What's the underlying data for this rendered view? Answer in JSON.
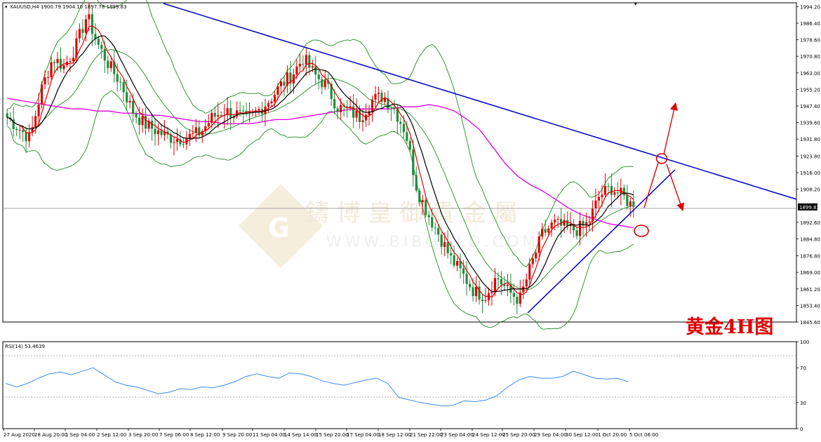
{
  "header": {
    "symbol": "XAUUSD,H4",
    "ohlc": "1900.79 1904.10 1897.78 1899.83"
  },
  "annotation_label": "黄金4H图",
  "watermark": {
    "cn": "鑄 博 皇 御 貴 金 屬",
    "en": "WWW.BIBGOLD.COM"
  },
  "rsi_header": "RSI(14) 53.4639",
  "colors": {
    "bull": "#e00000",
    "bear": "#1f8b3a",
    "ma_fast": "#e00000",
    "ma_slow": "#000000",
    "ma_long": "#e000e0",
    "bollinger": "#1f8b1f",
    "trendline": "#0000cc",
    "rsi": "#3c8cf0",
    "arrow": "#e00000"
  },
  "chart_data": [
    {
      "type": "candlestick",
      "title": "XAUUSD,H4",
      "ylim": [
        1845.6,
        1996.0
      ],
      "y_ticks": [
        "1994.20",
        "1986.40",
        "1978.60",
        "1970.80",
        "1963.00",
        "1955.20",
        "1947.40",
        "1939.60",
        "1931.80",
        "1923.80",
        "1916.00",
        "1908.20",
        "1899.83",
        "1892.60",
        "1884.80",
        "1876.80",
        "1869.00",
        "1861.20",
        "1853.40",
        "1845.60"
      ],
      "last_price": 1899.83,
      "x_tick_labels": [
        "27 Aug 2020",
        "28 Aug 20:00",
        "1 Sep 04:00",
        "2 Sep 12:00",
        "3 Sep 20:00",
        "7 Sep 06:00",
        "8 Sep 12:00",
        "9 Sep 20:00",
        "11 Sep 04:00",
        "14 Sep 14:00",
        "15 Sep 20:00",
        "17 Sep 04:00",
        "18 Sep 12:00",
        "21 Sep 22:00",
        "23 Sep 04:00",
        "24 Sep 12:00",
        "25 Sep 20:00",
        "29 Sep 04:00",
        "30 Sep 12:00",
        "1 Oct 20:00",
        "5 Oct 06:00"
      ],
      "close_path": [
        1942,
        1937,
        1932,
        1955,
        1970,
        1966,
        1975,
        1990,
        1976,
        1966,
        1958,
        1945,
        1939,
        1936,
        1933,
        1932,
        1933,
        1935,
        1942,
        1945,
        1944,
        1941,
        1945,
        1950,
        1957,
        1962,
        1970,
        1962,
        1957,
        1947,
        1945,
        1942,
        1950,
        1952,
        1946,
        1935,
        1908,
        1896,
        1886,
        1875,
        1868,
        1860,
        1858,
        1867,
        1860,
        1856,
        1872,
        1887,
        1892,
        1890,
        1889,
        1892,
        1905,
        1909,
        1905,
        1899.83
      ],
      "ma_long_path": [
        1951,
        1950,
        1949,
        1948,
        1947,
        1946,
        1946,
        1945,
        1945,
        1944,
        1944,
        1943,
        1943,
        1942,
        1941,
        1940,
        1940,
        1939,
        1939,
        1939,
        1940,
        1941,
        1941,
        1942,
        1943,
        1944,
        1945,
        1946,
        1946,
        1946,
        1946,
        1947,
        1947,
        1948,
        1947,
        1945,
        1941,
        1936,
        1928,
        1920,
        1914,
        1910,
        1907,
        1903,
        1899,
        1896,
        1894,
        1892,
        1891,
        1890
      ],
      "series": [
        {
          "name": "MA fast"
        },
        {
          "name": "MA slow"
        },
        {
          "name": "MA long"
        },
        {
          "name": "Bollinger Bands"
        }
      ]
    },
    {
      "type": "line",
      "title": "RSI(14) 53.4639",
      "ylim": [
        0,
        100
      ],
      "y_ticks": [
        100,
        70,
        30,
        0
      ],
      "series": [
        {
          "values": [
            52,
            48,
            52,
            58,
            63,
            65,
            62,
            66,
            70,
            62,
            54,
            50,
            48,
            44,
            40,
            42,
            46,
            45,
            48,
            47,
            50,
            54,
            60,
            63,
            60,
            58,
            64,
            63,
            60,
            55,
            52,
            50,
            53,
            56,
            58,
            52,
            36,
            33,
            30,
            28,
            26,
            27,
            32,
            31,
            33,
            38,
            48,
            56,
            60,
            58,
            58,
            60,
            66,
            62,
            58,
            57,
            58,
            54
          ]
        }
      ]
    }
  ]
}
